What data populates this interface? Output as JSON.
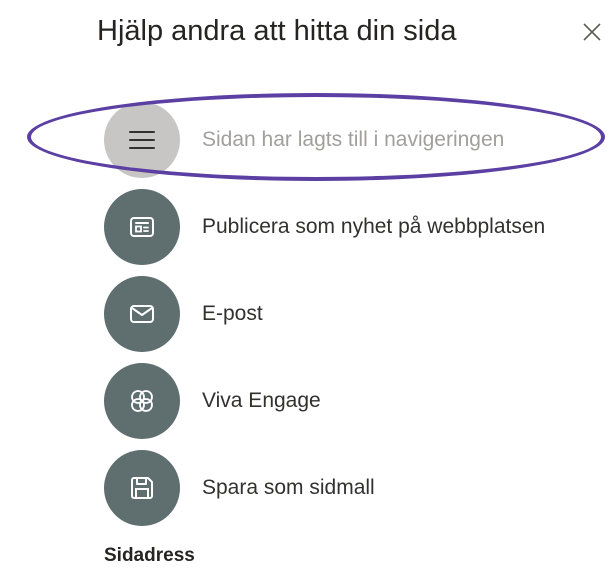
{
  "panel": {
    "title": "Hjälp andra att hitta din sida",
    "close_icon": "close-icon"
  },
  "actions": [
    {
      "label": "Sidan har lagts till i navigeringen",
      "icon": "navigation-menu-icon",
      "state": "disabled"
    },
    {
      "label": "Publicera som nyhet på webbplatsen",
      "icon": "news-icon",
      "state": "enabled"
    },
    {
      "label": "E-post",
      "icon": "mail-icon",
      "state": "enabled"
    },
    {
      "label": "Viva Engage",
      "icon": "viva-engage-icon",
      "state": "enabled"
    },
    {
      "label": "Spara som sidmall",
      "icon": "save-icon",
      "state": "enabled"
    }
  ],
  "section": {
    "label": "Sidadress"
  },
  "colors": {
    "icon_circle": "#5f6e6f",
    "icon_circle_disabled": "#c8c6c4",
    "highlight_ring": "#5b3fa3",
    "text": "#252423",
    "text_disabled": "#a19f9d"
  }
}
